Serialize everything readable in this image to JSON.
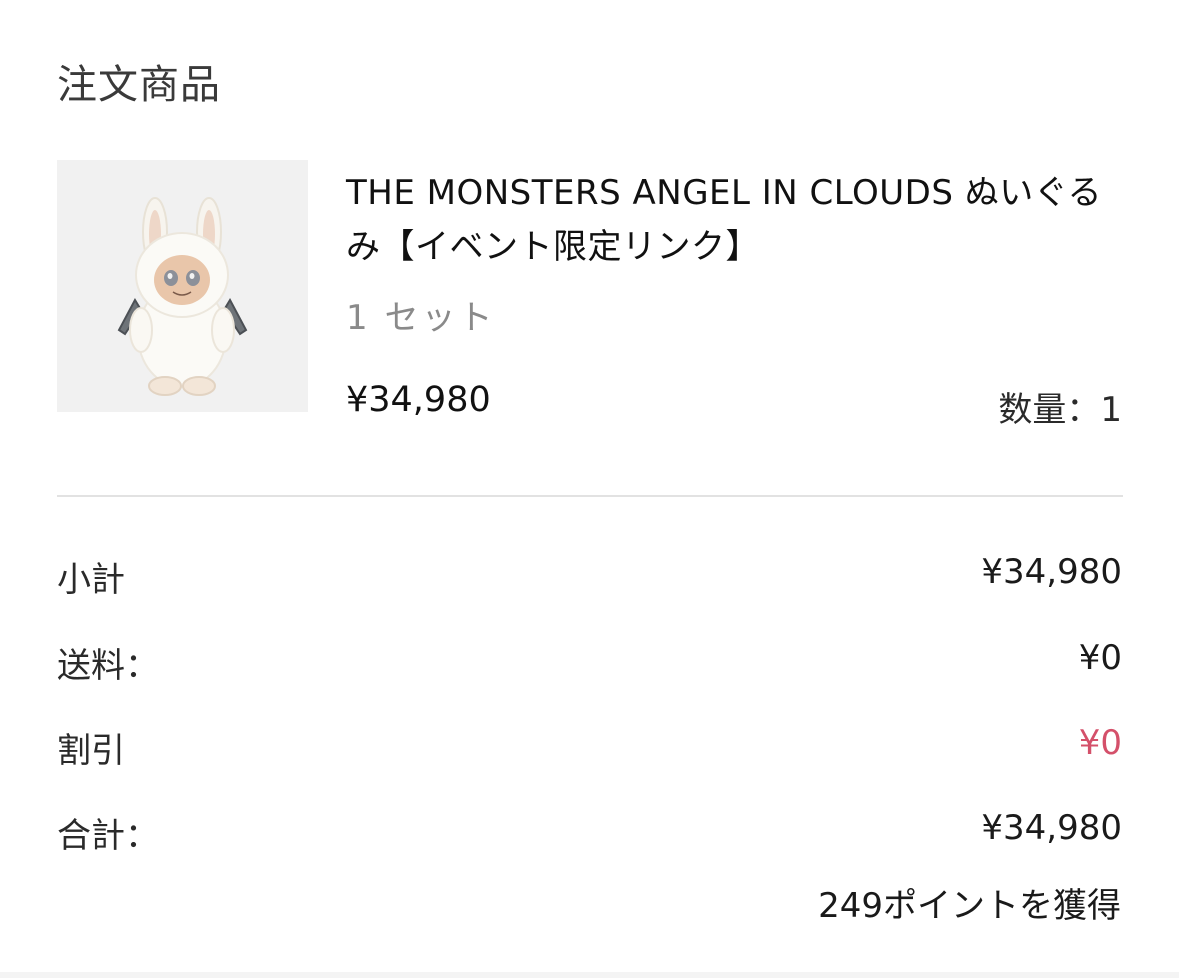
{
  "order_items": {
    "section_title": "注文商品",
    "product": {
      "name": "THE MONSTERS ANGEL IN CLOUDS ぬいぐるみ【イベント限定リンク】",
      "variant": "1 セット",
      "price": "¥34,980",
      "quantity_label": "数量：1"
    }
  },
  "summary": {
    "subtotal": {
      "label": "小計",
      "value": "¥34,980"
    },
    "shipping": {
      "label": "送料：",
      "value": "¥0"
    },
    "discount": {
      "label": "割引",
      "value": "¥0"
    },
    "total": {
      "label": "合計：",
      "value": "¥34,980"
    },
    "points_note": "249ポイントを獲得"
  },
  "colors": {
    "discount": "#d4506a",
    "divider": "#e2e2e2",
    "thumb_background": "#f1f1f1"
  }
}
